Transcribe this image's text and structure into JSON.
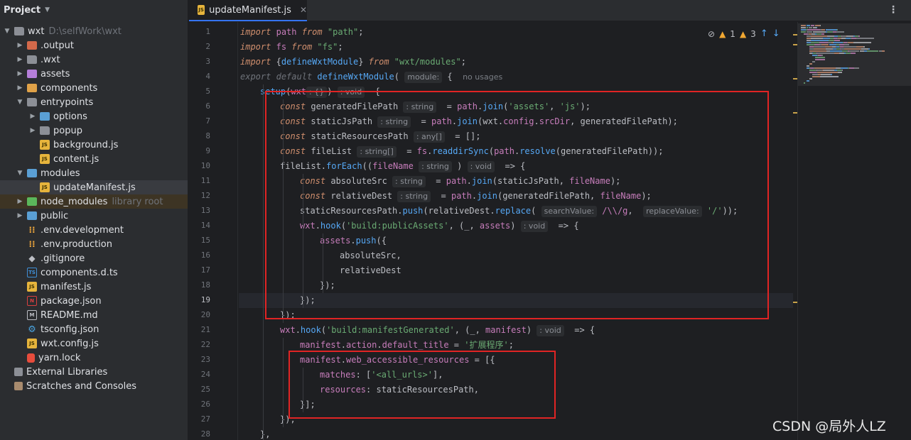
{
  "project_panel": {
    "title": "Project",
    "tree": [
      {
        "label": "wxt",
        "path": "D:\\selfWork\\wxt",
        "depth": 0,
        "expanded": true,
        "icon": "folder"
      },
      {
        "label": ".output",
        "depth": 1,
        "expanded": false,
        "icon": "folder-red"
      },
      {
        "label": ".wxt",
        "depth": 1,
        "expanded": false,
        "icon": "folder"
      },
      {
        "label": "assets",
        "depth": 1,
        "expanded": false,
        "icon": "folder-purple"
      },
      {
        "label": "components",
        "depth": 1,
        "expanded": false,
        "icon": "folder-orange"
      },
      {
        "label": "entrypoints",
        "depth": 1,
        "expanded": true,
        "icon": "folder"
      },
      {
        "label": "options",
        "depth": 2,
        "expanded": false,
        "icon": "folder-blue"
      },
      {
        "label": "popup",
        "depth": 2,
        "expanded": false,
        "icon": "folder"
      },
      {
        "label": "background.js",
        "depth": 2,
        "icon": "js"
      },
      {
        "label": "content.js",
        "depth": 2,
        "icon": "js"
      },
      {
        "label": "modules",
        "depth": 1,
        "expanded": true,
        "icon": "folder-blue"
      },
      {
        "label": "updateManifest.js",
        "depth": 2,
        "icon": "js",
        "selected": true
      },
      {
        "label": "node_modules",
        "path": "library root",
        "depth": 1,
        "expanded": false,
        "icon": "folder-green",
        "excluded": true
      },
      {
        "label": "public",
        "depth": 1,
        "expanded": false,
        "icon": "folder-blue"
      },
      {
        "label": ".env.development",
        "depth": 1,
        "icon": "env"
      },
      {
        "label": ".env.production",
        "depth": 1,
        "icon": "env"
      },
      {
        "label": ".gitignore",
        "depth": 1,
        "icon": "git"
      },
      {
        "label": "components.d.ts",
        "depth": 1,
        "icon": "ts"
      },
      {
        "label": "manifest.js",
        "depth": 1,
        "icon": "js"
      },
      {
        "label": "package.json",
        "depth": 1,
        "icon": "npm"
      },
      {
        "label": "README.md",
        "depth": 1,
        "icon": "md"
      },
      {
        "label": "tsconfig.json",
        "depth": 1,
        "icon": "gear"
      },
      {
        "label": "wxt.config.js",
        "depth": 1,
        "icon": "js"
      },
      {
        "label": "yarn.lock",
        "depth": 1,
        "icon": "lock"
      },
      {
        "label": "External Libraries",
        "depth": 0,
        "icon": "lib"
      },
      {
        "label": "Scratches and Consoles",
        "depth": 0,
        "icon": "scratch"
      }
    ]
  },
  "editor": {
    "tab": {
      "label": "updateManifest.js",
      "icon_text": "JS"
    },
    "current_line": 19,
    "inspections": {
      "warnings_a": "1",
      "warnings_b": "3"
    },
    "lines": [
      {
        "n": "1",
        "indent": 0,
        "tokens": [
          [
            "ki",
            "import"
          ],
          [
            "t",
            " "
          ],
          [
            "p",
            "path"
          ],
          [
            "t",
            " "
          ],
          [
            "ki",
            "from"
          ],
          [
            "t",
            " "
          ],
          [
            "s",
            "\"path\""
          ],
          [
            "t",
            ";"
          ]
        ]
      },
      {
        "n": "2",
        "indent": 0,
        "tokens": [
          [
            "ki",
            "import"
          ],
          [
            "t",
            " "
          ],
          [
            "p",
            "fs"
          ],
          [
            "t",
            " "
          ],
          [
            "ki",
            "from"
          ],
          [
            "t",
            " "
          ],
          [
            "s",
            "\"fs\""
          ],
          [
            "t",
            ";"
          ]
        ]
      },
      {
        "n": "3",
        "indent": 0,
        "tokens": [
          [
            "ki",
            "import"
          ],
          [
            "t",
            " {"
          ],
          [
            "f",
            "defineWxtModule"
          ],
          [
            "t",
            "} "
          ],
          [
            "ki",
            "from"
          ],
          [
            "t",
            " "
          ],
          [
            "s",
            "\"wxt/modules\""
          ],
          [
            "t",
            ";"
          ]
        ]
      },
      {
        "n": "4",
        "indent": 0,
        "tokens": [
          [
            "dimk",
            "export"
          ],
          [
            "t",
            " "
          ],
          [
            "dimk",
            "default"
          ],
          [
            "t",
            " "
          ],
          [
            "f",
            "defineWxtModule"
          ],
          [
            "t",
            "( "
          ],
          [
            "hint",
            "module:"
          ],
          [
            "t",
            " {  "
          ],
          [
            "hp",
            "no usages"
          ]
        ]
      },
      {
        "n": "5",
        "indent": 1,
        "tokens": [
          [
            "f",
            "setup"
          ],
          [
            "t",
            "("
          ],
          [
            "pa",
            "wxt"
          ],
          [
            "hint",
            ": {}"
          ],
          [
            "t",
            ") "
          ],
          [
            "hint",
            ": void"
          ],
          [
            "t",
            "  {"
          ]
        ]
      },
      {
        "n": "6",
        "indent": 2,
        "tokens": [
          [
            "ki",
            "const"
          ],
          [
            "t",
            " generatedFilePath "
          ],
          [
            "hint",
            ": string"
          ],
          [
            "t",
            "  = "
          ],
          [
            "p",
            "path"
          ],
          [
            "t",
            "."
          ],
          [
            "f",
            "join"
          ],
          [
            "t",
            "("
          ],
          [
            "s",
            "'assets'"
          ],
          [
            "t",
            ", "
          ],
          [
            "s",
            "'js'"
          ],
          [
            "t",
            ");"
          ]
        ]
      },
      {
        "n": "7",
        "indent": 2,
        "tokens": [
          [
            "ki",
            "const"
          ],
          [
            "t",
            " staticJsPath "
          ],
          [
            "hint",
            ": string"
          ],
          [
            "t",
            "  = "
          ],
          [
            "p",
            "path"
          ],
          [
            "t",
            "."
          ],
          [
            "f",
            "join"
          ],
          [
            "t",
            "(wxt."
          ],
          [
            "p",
            "config"
          ],
          [
            "t",
            "."
          ],
          [
            "p",
            "srcDir"
          ],
          [
            "t",
            ", generatedFilePath);"
          ]
        ]
      },
      {
        "n": "8",
        "indent": 2,
        "tokens": [
          [
            "ki",
            "const"
          ],
          [
            "t",
            " staticResourcesPath "
          ],
          [
            "hint",
            ": any[]"
          ],
          [
            "t",
            "  = [];"
          ]
        ]
      },
      {
        "n": "9",
        "indent": 2,
        "tokens": [
          [
            "ki",
            "const"
          ],
          [
            "t",
            " fileList "
          ],
          [
            "hint",
            ": string[]"
          ],
          [
            "t",
            "  = "
          ],
          [
            "p",
            "fs"
          ],
          [
            "t",
            "."
          ],
          [
            "f",
            "readdirSync"
          ],
          [
            "t",
            "("
          ],
          [
            "p",
            "path"
          ],
          [
            "t",
            "."
          ],
          [
            "f",
            "resolve"
          ],
          [
            "t",
            "(generatedFilePath));"
          ]
        ]
      },
      {
        "n": "10",
        "indent": 2,
        "tokens": [
          [
            "t",
            "fileList."
          ],
          [
            "f",
            "forEach"
          ],
          [
            "t",
            "(("
          ],
          [
            "pa",
            "fileName"
          ],
          [
            "t",
            " "
          ],
          [
            "hint",
            ": string"
          ],
          [
            "t",
            " ) "
          ],
          [
            "hint",
            ": void"
          ],
          [
            "t",
            "  => {"
          ]
        ]
      },
      {
        "n": "11",
        "indent": 3,
        "tokens": [
          [
            "ki",
            "const"
          ],
          [
            "t",
            " absoluteSrc "
          ],
          [
            "hint",
            ": string"
          ],
          [
            "t",
            "  = "
          ],
          [
            "p",
            "path"
          ],
          [
            "t",
            "."
          ],
          [
            "f",
            "join"
          ],
          [
            "t",
            "(staticJsPath, "
          ],
          [
            "pa",
            "fileName"
          ],
          [
            "t",
            ");"
          ]
        ]
      },
      {
        "n": "12",
        "indent": 3,
        "tokens": [
          [
            "ki",
            "const"
          ],
          [
            "t",
            " relativeDest "
          ],
          [
            "hint",
            ": string"
          ],
          [
            "t",
            "  = "
          ],
          [
            "p",
            "path"
          ],
          [
            "t",
            "."
          ],
          [
            "f",
            "join"
          ],
          [
            "t",
            "(generatedFilePath, "
          ],
          [
            "pa",
            "fileName"
          ],
          [
            "t",
            ");"
          ]
        ]
      },
      {
        "n": "13",
        "indent": 3,
        "tokens": [
          [
            "t",
            "staticResourcesPath."
          ],
          [
            "f",
            "push"
          ],
          [
            "t",
            "(relativeDest."
          ],
          [
            "f",
            "replace"
          ],
          [
            "t",
            "( "
          ],
          [
            "hint",
            "searchValue:"
          ],
          [
            "t",
            " "
          ],
          [
            "pa",
            "/\\\\/g"
          ],
          [
            "t",
            ",  "
          ],
          [
            "hint",
            "replaceValue:"
          ],
          [
            "t",
            " "
          ],
          [
            "s",
            "'/'"
          ],
          [
            "t",
            "));"
          ]
        ]
      },
      {
        "n": "14",
        "indent": 3,
        "tokens": [
          [
            "p",
            "wxt"
          ],
          [
            "t",
            "."
          ],
          [
            "f",
            "hook"
          ],
          [
            "t",
            "("
          ],
          [
            "s",
            "'build:publicAssets'"
          ],
          [
            "t",
            ", (_, "
          ],
          [
            "p",
            "assets"
          ],
          [
            "t",
            ") "
          ],
          [
            "hint",
            ": void"
          ],
          [
            "t",
            "  => {"
          ]
        ]
      },
      {
        "n": "15",
        "indent": 4,
        "tokens": [
          [
            "p",
            "assets"
          ],
          [
            "t",
            "."
          ],
          [
            "f",
            "push"
          ],
          [
            "t",
            "({"
          ]
        ]
      },
      {
        "n": "16",
        "indent": 5,
        "tokens": [
          [
            "t",
            "absoluteSrc,"
          ]
        ]
      },
      {
        "n": "17",
        "indent": 5,
        "tokens": [
          [
            "t",
            "relativeDest"
          ]
        ]
      },
      {
        "n": "18",
        "indent": 4,
        "tokens": [
          [
            "t",
            "});"
          ]
        ]
      },
      {
        "n": "19",
        "indent": 3,
        "tokens": [
          [
            "t",
            "});"
          ]
        ]
      },
      {
        "n": "20",
        "indent": 2,
        "tokens": [
          [
            "t",
            "});"
          ]
        ]
      },
      {
        "n": "21",
        "indent": 2,
        "tokens": [
          [
            "p",
            "wxt"
          ],
          [
            "t",
            "."
          ],
          [
            "f",
            "hook"
          ],
          [
            "t",
            "("
          ],
          [
            "s",
            "'build:manifestGenerated'"
          ],
          [
            "t",
            ", (_, "
          ],
          [
            "p",
            "manifest"
          ],
          [
            "t",
            ") "
          ],
          [
            "hint",
            ": void"
          ],
          [
            "t",
            "  => {"
          ]
        ]
      },
      {
        "n": "22",
        "indent": 3,
        "tokens": [
          [
            "p",
            "manifest"
          ],
          [
            "t",
            "."
          ],
          [
            "p",
            "action"
          ],
          [
            "t",
            "."
          ],
          [
            "p",
            "default_title"
          ],
          [
            "t",
            " = "
          ],
          [
            "s",
            "'扩展程序'"
          ],
          [
            "t",
            ";"
          ]
        ]
      },
      {
        "n": "23",
        "indent": 3,
        "tokens": [
          [
            "p",
            "manifest"
          ],
          [
            "t",
            "."
          ],
          [
            "p",
            "web_accessible_resources"
          ],
          [
            "t",
            " = [{"
          ]
        ]
      },
      {
        "n": "24",
        "indent": 4,
        "tokens": [
          [
            "p",
            "matches"
          ],
          [
            "t",
            ": ["
          ],
          [
            "s",
            "'<all_urls>'"
          ],
          [
            "t",
            "],"
          ]
        ]
      },
      {
        "n": "25",
        "indent": 4,
        "tokens": [
          [
            "p",
            "resources"
          ],
          [
            "t",
            ": staticResourcesPath,"
          ]
        ]
      },
      {
        "n": "26",
        "indent": 3,
        "tokens": [
          [
            "t",
            "}];"
          ]
        ]
      },
      {
        "n": "27",
        "indent": 2,
        "tokens": [
          [
            "t",
            "});"
          ]
        ]
      },
      {
        "n": "28",
        "indent": 1,
        "tokens": [
          [
            "t",
            "},"
          ]
        ]
      }
    ]
  },
  "colors": {
    "highlight_box": "#e02424",
    "accent": "#3574f0",
    "warning": "#f0a732"
  },
  "watermark": "CSDN @局外人LZ"
}
